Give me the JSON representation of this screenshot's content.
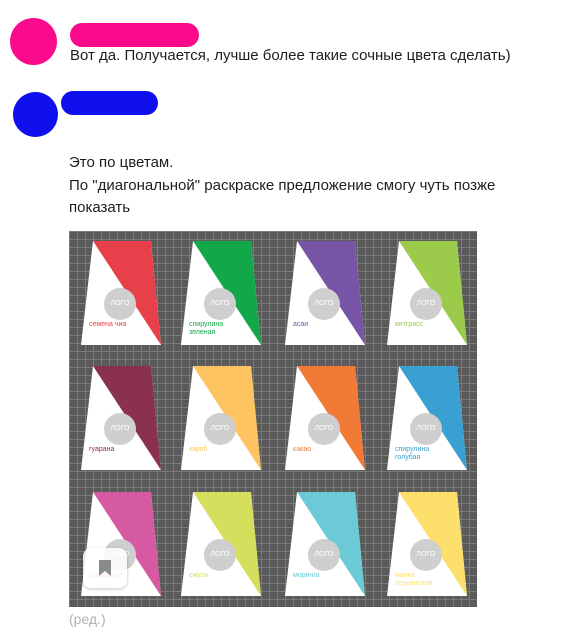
{
  "messages": [
    {
      "text": "Вот да. Получается, лучше более такие сочные цвета сделать)",
      "avatar_color": "#fa0a8c",
      "name_mark_color": "#fb0b8c"
    },
    {
      "lines": [
        "Это по цветам.",
        "По \"диагональной\" раскраске предложение смогу чуть позже",
        "показать"
      ],
      "avatar_color": "#1010ee",
      "name_mark_color": "#1010ee"
    }
  ],
  "attachment": {
    "logo_text": "ЛОГО",
    "cards": [
      {
        "label": "семена чиа",
        "color": "#e8404a"
      },
      {
        "label": "спирулина\nзеленая",
        "color": "#12a84a"
      },
      {
        "label": "асаи",
        "color": "#7654a6"
      },
      {
        "label": "витграсс",
        "color": "#9ccb4b"
      },
      {
        "label": "гуарана",
        "color": "#8a3150"
      },
      {
        "label": "кэроб",
        "color": "#fec462"
      },
      {
        "label": "какао",
        "color": "#f17a36"
      },
      {
        "label": "спирулина\nголубая",
        "color": "#3a9fd1"
      },
      {
        "label": "грейпфрут",
        "color": "#d65aa1"
      },
      {
        "label": "смузи",
        "color": "#d4df5e"
      },
      {
        "label": "моринга",
        "color": "#6cc9d6"
      },
      {
        "label": "манка\nперуанская",
        "color": "#fde06c"
      }
    ]
  },
  "edited_label": "(ред.)"
}
